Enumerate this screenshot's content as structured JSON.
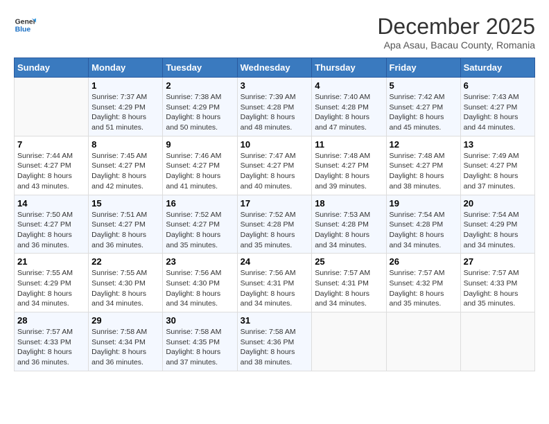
{
  "header": {
    "logo_line1": "General",
    "logo_line2": "Blue",
    "month": "December 2025",
    "location": "Apa Asau, Bacau County, Romania"
  },
  "weekdays": [
    "Sunday",
    "Monday",
    "Tuesday",
    "Wednesday",
    "Thursday",
    "Friday",
    "Saturday"
  ],
  "weeks": [
    [
      {
        "day": "",
        "sunrise": "",
        "sunset": "",
        "daylight": ""
      },
      {
        "day": "1",
        "sunrise": "Sunrise: 7:37 AM",
        "sunset": "Sunset: 4:29 PM",
        "daylight": "Daylight: 8 hours and 51 minutes."
      },
      {
        "day": "2",
        "sunrise": "Sunrise: 7:38 AM",
        "sunset": "Sunset: 4:29 PM",
        "daylight": "Daylight: 8 hours and 50 minutes."
      },
      {
        "day": "3",
        "sunrise": "Sunrise: 7:39 AM",
        "sunset": "Sunset: 4:28 PM",
        "daylight": "Daylight: 8 hours and 48 minutes."
      },
      {
        "day": "4",
        "sunrise": "Sunrise: 7:40 AM",
        "sunset": "Sunset: 4:28 PM",
        "daylight": "Daylight: 8 hours and 47 minutes."
      },
      {
        "day": "5",
        "sunrise": "Sunrise: 7:42 AM",
        "sunset": "Sunset: 4:27 PM",
        "daylight": "Daylight: 8 hours and 45 minutes."
      },
      {
        "day": "6",
        "sunrise": "Sunrise: 7:43 AM",
        "sunset": "Sunset: 4:27 PM",
        "daylight": "Daylight: 8 hours and 44 minutes."
      }
    ],
    [
      {
        "day": "7",
        "sunrise": "Sunrise: 7:44 AM",
        "sunset": "Sunset: 4:27 PM",
        "daylight": "Daylight: 8 hours and 43 minutes."
      },
      {
        "day": "8",
        "sunrise": "Sunrise: 7:45 AM",
        "sunset": "Sunset: 4:27 PM",
        "daylight": "Daylight: 8 hours and 42 minutes."
      },
      {
        "day": "9",
        "sunrise": "Sunrise: 7:46 AM",
        "sunset": "Sunset: 4:27 PM",
        "daylight": "Daylight: 8 hours and 41 minutes."
      },
      {
        "day": "10",
        "sunrise": "Sunrise: 7:47 AM",
        "sunset": "Sunset: 4:27 PM",
        "daylight": "Daylight: 8 hours and 40 minutes."
      },
      {
        "day": "11",
        "sunrise": "Sunrise: 7:48 AM",
        "sunset": "Sunset: 4:27 PM",
        "daylight": "Daylight: 8 hours and 39 minutes."
      },
      {
        "day": "12",
        "sunrise": "Sunrise: 7:48 AM",
        "sunset": "Sunset: 4:27 PM",
        "daylight": "Daylight: 8 hours and 38 minutes."
      },
      {
        "day": "13",
        "sunrise": "Sunrise: 7:49 AM",
        "sunset": "Sunset: 4:27 PM",
        "daylight": "Daylight: 8 hours and 37 minutes."
      }
    ],
    [
      {
        "day": "14",
        "sunrise": "Sunrise: 7:50 AM",
        "sunset": "Sunset: 4:27 PM",
        "daylight": "Daylight: 8 hours and 36 minutes."
      },
      {
        "day": "15",
        "sunrise": "Sunrise: 7:51 AM",
        "sunset": "Sunset: 4:27 PM",
        "daylight": "Daylight: 8 hours and 36 minutes."
      },
      {
        "day": "16",
        "sunrise": "Sunrise: 7:52 AM",
        "sunset": "Sunset: 4:27 PM",
        "daylight": "Daylight: 8 hours and 35 minutes."
      },
      {
        "day": "17",
        "sunrise": "Sunrise: 7:52 AM",
        "sunset": "Sunset: 4:28 PM",
        "daylight": "Daylight: 8 hours and 35 minutes."
      },
      {
        "day": "18",
        "sunrise": "Sunrise: 7:53 AM",
        "sunset": "Sunset: 4:28 PM",
        "daylight": "Daylight: 8 hours and 34 minutes."
      },
      {
        "day": "19",
        "sunrise": "Sunrise: 7:54 AM",
        "sunset": "Sunset: 4:28 PM",
        "daylight": "Daylight: 8 hours and 34 minutes."
      },
      {
        "day": "20",
        "sunrise": "Sunrise: 7:54 AM",
        "sunset": "Sunset: 4:29 PM",
        "daylight": "Daylight: 8 hours and 34 minutes."
      }
    ],
    [
      {
        "day": "21",
        "sunrise": "Sunrise: 7:55 AM",
        "sunset": "Sunset: 4:29 PM",
        "daylight": "Daylight: 8 hours and 34 minutes."
      },
      {
        "day": "22",
        "sunrise": "Sunrise: 7:55 AM",
        "sunset": "Sunset: 4:30 PM",
        "daylight": "Daylight: 8 hours and 34 minutes."
      },
      {
        "day": "23",
        "sunrise": "Sunrise: 7:56 AM",
        "sunset": "Sunset: 4:30 PM",
        "daylight": "Daylight: 8 hours and 34 minutes."
      },
      {
        "day": "24",
        "sunrise": "Sunrise: 7:56 AM",
        "sunset": "Sunset: 4:31 PM",
        "daylight": "Daylight: 8 hours and 34 minutes."
      },
      {
        "day": "25",
        "sunrise": "Sunrise: 7:57 AM",
        "sunset": "Sunset: 4:31 PM",
        "daylight": "Daylight: 8 hours and 34 minutes."
      },
      {
        "day": "26",
        "sunrise": "Sunrise: 7:57 AM",
        "sunset": "Sunset: 4:32 PM",
        "daylight": "Daylight: 8 hours and 35 minutes."
      },
      {
        "day": "27",
        "sunrise": "Sunrise: 7:57 AM",
        "sunset": "Sunset: 4:33 PM",
        "daylight": "Daylight: 8 hours and 35 minutes."
      }
    ],
    [
      {
        "day": "28",
        "sunrise": "Sunrise: 7:57 AM",
        "sunset": "Sunset: 4:33 PM",
        "daylight": "Daylight: 8 hours and 36 minutes."
      },
      {
        "day": "29",
        "sunrise": "Sunrise: 7:58 AM",
        "sunset": "Sunset: 4:34 PM",
        "daylight": "Daylight: 8 hours and 36 minutes."
      },
      {
        "day": "30",
        "sunrise": "Sunrise: 7:58 AM",
        "sunset": "Sunset: 4:35 PM",
        "daylight": "Daylight: 8 hours and 37 minutes."
      },
      {
        "day": "31",
        "sunrise": "Sunrise: 7:58 AM",
        "sunset": "Sunset: 4:36 PM",
        "daylight": "Daylight: 8 hours and 38 minutes."
      },
      {
        "day": "",
        "sunrise": "",
        "sunset": "",
        "daylight": ""
      },
      {
        "day": "",
        "sunrise": "",
        "sunset": "",
        "daylight": ""
      },
      {
        "day": "",
        "sunrise": "",
        "sunset": "",
        "daylight": ""
      }
    ]
  ]
}
